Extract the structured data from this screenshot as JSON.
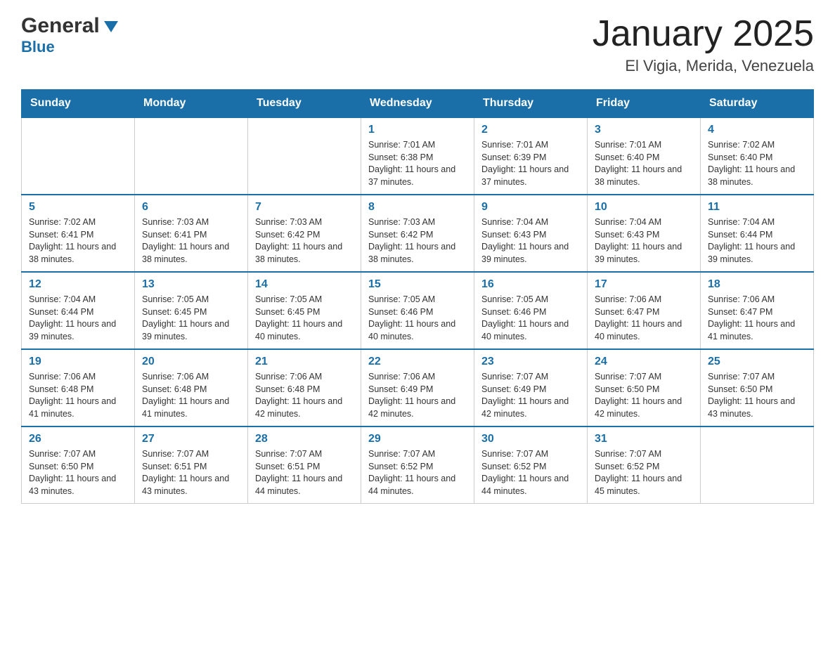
{
  "header": {
    "logo_general": "General",
    "logo_blue": "Blue",
    "title": "January 2025",
    "location": "El Vigia, Merida, Venezuela"
  },
  "days_of_week": [
    "Sunday",
    "Monday",
    "Tuesday",
    "Wednesday",
    "Thursday",
    "Friday",
    "Saturday"
  ],
  "weeks": [
    [
      {
        "day": "",
        "info": ""
      },
      {
        "day": "",
        "info": ""
      },
      {
        "day": "",
        "info": ""
      },
      {
        "day": "1",
        "info": "Sunrise: 7:01 AM\nSunset: 6:38 PM\nDaylight: 11 hours and 37 minutes."
      },
      {
        "day": "2",
        "info": "Sunrise: 7:01 AM\nSunset: 6:39 PM\nDaylight: 11 hours and 37 minutes."
      },
      {
        "day": "3",
        "info": "Sunrise: 7:01 AM\nSunset: 6:40 PM\nDaylight: 11 hours and 38 minutes."
      },
      {
        "day": "4",
        "info": "Sunrise: 7:02 AM\nSunset: 6:40 PM\nDaylight: 11 hours and 38 minutes."
      }
    ],
    [
      {
        "day": "5",
        "info": "Sunrise: 7:02 AM\nSunset: 6:41 PM\nDaylight: 11 hours and 38 minutes."
      },
      {
        "day": "6",
        "info": "Sunrise: 7:03 AM\nSunset: 6:41 PM\nDaylight: 11 hours and 38 minutes."
      },
      {
        "day": "7",
        "info": "Sunrise: 7:03 AM\nSunset: 6:42 PM\nDaylight: 11 hours and 38 minutes."
      },
      {
        "day": "8",
        "info": "Sunrise: 7:03 AM\nSunset: 6:42 PM\nDaylight: 11 hours and 38 minutes."
      },
      {
        "day": "9",
        "info": "Sunrise: 7:04 AM\nSunset: 6:43 PM\nDaylight: 11 hours and 39 minutes."
      },
      {
        "day": "10",
        "info": "Sunrise: 7:04 AM\nSunset: 6:43 PM\nDaylight: 11 hours and 39 minutes."
      },
      {
        "day": "11",
        "info": "Sunrise: 7:04 AM\nSunset: 6:44 PM\nDaylight: 11 hours and 39 minutes."
      }
    ],
    [
      {
        "day": "12",
        "info": "Sunrise: 7:04 AM\nSunset: 6:44 PM\nDaylight: 11 hours and 39 minutes."
      },
      {
        "day": "13",
        "info": "Sunrise: 7:05 AM\nSunset: 6:45 PM\nDaylight: 11 hours and 39 minutes."
      },
      {
        "day": "14",
        "info": "Sunrise: 7:05 AM\nSunset: 6:45 PM\nDaylight: 11 hours and 40 minutes."
      },
      {
        "day": "15",
        "info": "Sunrise: 7:05 AM\nSunset: 6:46 PM\nDaylight: 11 hours and 40 minutes."
      },
      {
        "day": "16",
        "info": "Sunrise: 7:05 AM\nSunset: 6:46 PM\nDaylight: 11 hours and 40 minutes."
      },
      {
        "day": "17",
        "info": "Sunrise: 7:06 AM\nSunset: 6:47 PM\nDaylight: 11 hours and 40 minutes."
      },
      {
        "day": "18",
        "info": "Sunrise: 7:06 AM\nSunset: 6:47 PM\nDaylight: 11 hours and 41 minutes."
      }
    ],
    [
      {
        "day": "19",
        "info": "Sunrise: 7:06 AM\nSunset: 6:48 PM\nDaylight: 11 hours and 41 minutes."
      },
      {
        "day": "20",
        "info": "Sunrise: 7:06 AM\nSunset: 6:48 PM\nDaylight: 11 hours and 41 minutes."
      },
      {
        "day": "21",
        "info": "Sunrise: 7:06 AM\nSunset: 6:48 PM\nDaylight: 11 hours and 42 minutes."
      },
      {
        "day": "22",
        "info": "Sunrise: 7:06 AM\nSunset: 6:49 PM\nDaylight: 11 hours and 42 minutes."
      },
      {
        "day": "23",
        "info": "Sunrise: 7:07 AM\nSunset: 6:49 PM\nDaylight: 11 hours and 42 minutes."
      },
      {
        "day": "24",
        "info": "Sunrise: 7:07 AM\nSunset: 6:50 PM\nDaylight: 11 hours and 42 minutes."
      },
      {
        "day": "25",
        "info": "Sunrise: 7:07 AM\nSunset: 6:50 PM\nDaylight: 11 hours and 43 minutes."
      }
    ],
    [
      {
        "day": "26",
        "info": "Sunrise: 7:07 AM\nSunset: 6:50 PM\nDaylight: 11 hours and 43 minutes."
      },
      {
        "day": "27",
        "info": "Sunrise: 7:07 AM\nSunset: 6:51 PM\nDaylight: 11 hours and 43 minutes."
      },
      {
        "day": "28",
        "info": "Sunrise: 7:07 AM\nSunset: 6:51 PM\nDaylight: 11 hours and 44 minutes."
      },
      {
        "day": "29",
        "info": "Sunrise: 7:07 AM\nSunset: 6:52 PM\nDaylight: 11 hours and 44 minutes."
      },
      {
        "day": "30",
        "info": "Sunrise: 7:07 AM\nSunset: 6:52 PM\nDaylight: 11 hours and 44 minutes."
      },
      {
        "day": "31",
        "info": "Sunrise: 7:07 AM\nSunset: 6:52 PM\nDaylight: 11 hours and 45 minutes."
      },
      {
        "day": "",
        "info": ""
      }
    ]
  ]
}
